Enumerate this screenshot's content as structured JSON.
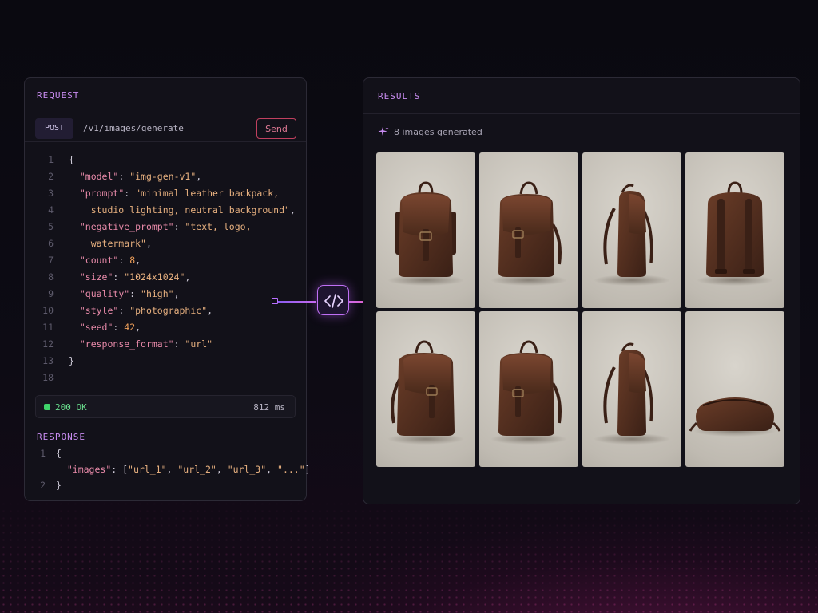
{
  "request": {
    "section_title": "REQUEST",
    "method": "POST",
    "endpoint": "/v1/images/generate",
    "send_label": "Send",
    "code_lines": [
      {
        "n": "1",
        "parts": [
          {
            "t": "{",
            "c": "p"
          }
        ]
      },
      {
        "n": "2",
        "parts": [
          {
            "t": "  ",
            "c": "p"
          },
          {
            "t": "\"model\"",
            "c": "k"
          },
          {
            "t": ": ",
            "c": "p"
          },
          {
            "t": "\"img-gen-v1\"",
            "c": "s"
          },
          {
            "t": ",",
            "c": "p"
          }
        ]
      },
      {
        "n": "3",
        "parts": [
          {
            "t": "  ",
            "c": "p"
          },
          {
            "t": "\"prompt\"",
            "c": "k"
          },
          {
            "t": ": ",
            "c": "p"
          },
          {
            "t": "\"minimal leather backpack,",
            "c": "s"
          }
        ]
      },
      {
        "n": "4",
        "parts": [
          {
            "t": "    studio lighting, neutral background\"",
            "c": "s"
          },
          {
            "t": ",",
            "c": "p"
          }
        ]
      },
      {
        "n": "5",
        "parts": [
          {
            "t": "  ",
            "c": "p"
          },
          {
            "t": "\"negative_prompt\"",
            "c": "k"
          },
          {
            "t": ": ",
            "c": "p"
          },
          {
            "t": "\"text, logo,",
            "c": "s"
          }
        ]
      },
      {
        "n": "6",
        "parts": [
          {
            "t": "    watermark\"",
            "c": "s"
          },
          {
            "t": ",",
            "c": "p"
          }
        ]
      },
      {
        "n": "7",
        "parts": [
          {
            "t": "  ",
            "c": "p"
          },
          {
            "t": "\"count\"",
            "c": "k"
          },
          {
            "t": ": ",
            "c": "p"
          },
          {
            "t": "8",
            "c": "n"
          },
          {
            "t": ",",
            "c": "p"
          }
        ]
      },
      {
        "n": "8",
        "parts": [
          {
            "t": "  ",
            "c": "p"
          },
          {
            "t": "\"size\"",
            "c": "k"
          },
          {
            "t": ": ",
            "c": "p"
          },
          {
            "t": "\"1024x1024\"",
            "c": "s"
          },
          {
            "t": ",",
            "c": "p"
          }
        ]
      },
      {
        "n": "9",
        "parts": [
          {
            "t": "  ",
            "c": "p"
          },
          {
            "t": "\"quality\"",
            "c": "k"
          },
          {
            "t": ": ",
            "c": "p"
          },
          {
            "t": "\"high\"",
            "c": "s"
          },
          {
            "t": ",",
            "c": "p"
          }
        ]
      },
      {
        "n": "10",
        "parts": [
          {
            "t": "  ",
            "c": "p"
          },
          {
            "t": "\"style\"",
            "c": "k"
          },
          {
            "t": ": ",
            "c": "p"
          },
          {
            "t": "\"photographic\"",
            "c": "s"
          },
          {
            "t": ",",
            "c": "p"
          }
        ]
      },
      {
        "n": "11",
        "parts": [
          {
            "t": "  ",
            "c": "p"
          },
          {
            "t": "\"seed\"",
            "c": "k"
          },
          {
            "t": ": ",
            "c": "p"
          },
          {
            "t": "42",
            "c": "n"
          },
          {
            "t": ",",
            "c": "p"
          }
        ]
      },
      {
        "n": "12",
        "parts": [
          {
            "t": "  ",
            "c": "p"
          },
          {
            "t": "\"response_format\"",
            "c": "k"
          },
          {
            "t": ": ",
            "c": "p"
          },
          {
            "t": "\"url\"",
            "c": "s"
          }
        ]
      },
      {
        "n": "13",
        "parts": [
          {
            "t": "}",
            "c": "p"
          }
        ]
      },
      {
        "n": "18",
        "parts": []
      }
    ],
    "status": {
      "text": "200 OK",
      "time": "812 ms",
      "color": "#3fd46a"
    }
  },
  "response": {
    "section_title": "RESPONSE",
    "code_lines": [
      {
        "n": "1",
        "parts": [
          {
            "t": "{",
            "c": "p"
          }
        ]
      },
      {
        "n": "",
        "parts": [
          {
            "t": "  ",
            "c": "p"
          },
          {
            "t": "\"images\"",
            "c": "k"
          },
          {
            "t": ": [",
            "c": "p"
          },
          {
            "t": "\"url_1\"",
            "c": "s"
          },
          {
            "t": ", ",
            "c": "p"
          },
          {
            "t": "\"url_2\"",
            "c": "s"
          },
          {
            "t": ", ",
            "c": "p"
          },
          {
            "t": "\"url_3\"",
            "c": "s"
          },
          {
            "t": ", ",
            "c": "p"
          },
          {
            "t": "\"...\"",
            "c": "s"
          },
          {
            "t": "]",
            "c": "p"
          }
        ]
      },
      {
        "n": "2",
        "parts": [
          {
            "t": "}",
            "c": "p"
          }
        ]
      }
    ]
  },
  "connector": {
    "icon": "code-icon"
  },
  "results": {
    "section_title": "RESULTS",
    "generated_text": "8 images generated",
    "images": [
      {
        "view": "front-open",
        "icon": "backpack-front-icon"
      },
      {
        "view": "front-three-quarter",
        "icon": "backpack-front-icon"
      },
      {
        "view": "side",
        "icon": "backpack-side-icon"
      },
      {
        "view": "back",
        "icon": "backpack-back-icon"
      },
      {
        "view": "angle-left",
        "icon": "backpack-front-icon"
      },
      {
        "view": "front-three-quarter",
        "icon": "backpack-front-icon"
      },
      {
        "view": "side",
        "icon": "backpack-side-icon"
      },
      {
        "view": "lying",
        "icon": "backpack-lying-icon"
      }
    ]
  },
  "colors": {
    "accent_purple": "#c88cf0",
    "send_border": "#c0405f",
    "leather_dark": "#3a2016",
    "leather_mid": "#5a3322"
  }
}
